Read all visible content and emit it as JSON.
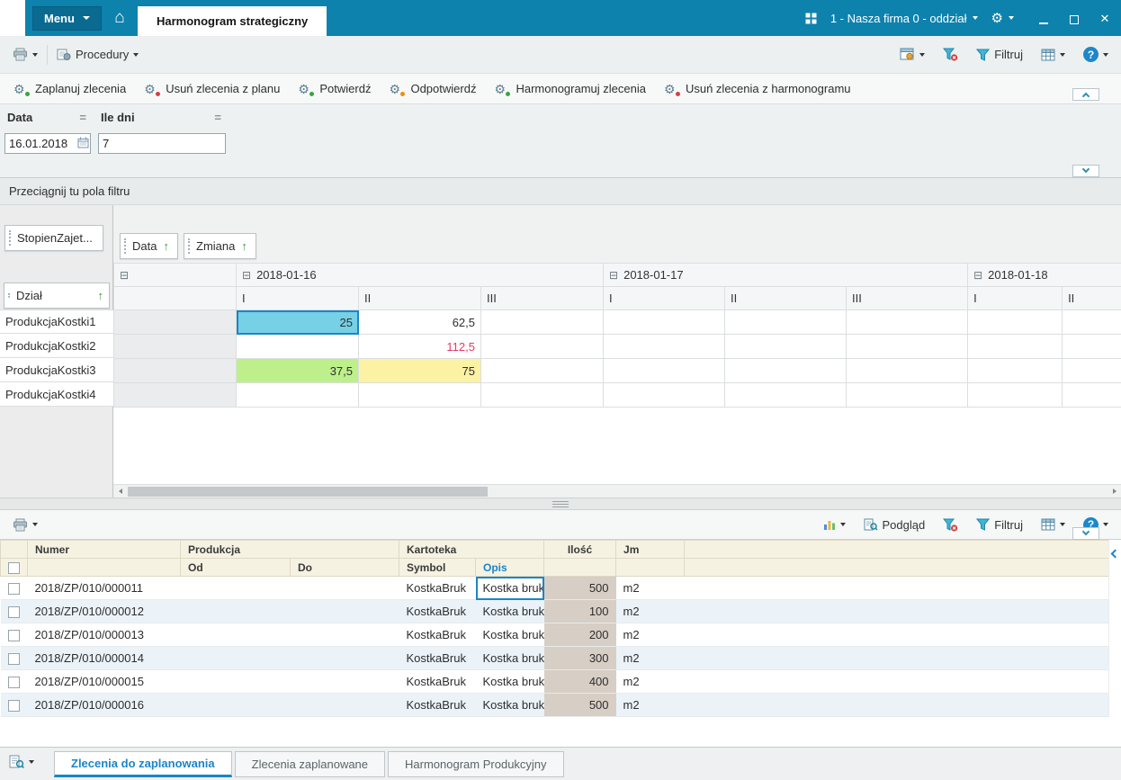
{
  "colors": {
    "titlebar": "#0d82ad",
    "accent_blue": "#1b85c8",
    "selected_cell": "#76d0e6",
    "cell_green": "#bdf08b",
    "cell_yellow": "#fbf2a4",
    "negative_red": "#e23b68",
    "ilosc_column_bg": "#d7cec6"
  },
  "icons": {
    "gears": "⚙",
    "home": "⌂",
    "sort_asc": "↑",
    "equals": "=",
    "collapse_box": "⊟",
    "question_mark": "?",
    "close": "✕"
  },
  "titlebar": {
    "menu_label": "Menu",
    "tab_title": "Harmonogram strategiczny",
    "company_selector": "1 - Nasza firma 0 - oddział"
  },
  "toolbar_top": {
    "procedures_label": "Procedury",
    "filter_label": "Filtruj"
  },
  "action_buttons": [
    {
      "label": "Zaplanuj zlecenia"
    },
    {
      "label": "Usuń zlecenia z planu"
    },
    {
      "label": "Potwierdź"
    },
    {
      "label": "Odpotwierdź"
    },
    {
      "label": "Harmonogramuj zlecenia"
    },
    {
      "label": "Usuń zlecenia z harmonogramu"
    }
  ],
  "params": {
    "date_label": "Data",
    "date_value": "16.01.2018",
    "days_label": "Ile dni",
    "days_value": "7"
  },
  "pivot": {
    "drop_hint": "Przeciągnij tu pola filtru",
    "data_field_label": "StopienZajet...",
    "column_field_1": "Data",
    "column_field_2": "Zmiana",
    "row_field": "Dział",
    "column_groups": [
      {
        "label": "2018-01-16",
        "subs": [
          "I",
          "II",
          "III"
        ]
      },
      {
        "label": "2018-01-17",
        "subs": [
          "I",
          "II",
          "III"
        ]
      },
      {
        "label": "2018-01-18",
        "subs": [
          "I",
          "II"
        ]
      }
    ],
    "rows": [
      {
        "label": "ProdukcjaKostki1",
        "values": [
          "25",
          "62,5",
          "",
          "",
          "",
          "",
          "",
          ""
        ]
      },
      {
        "label": "ProdukcjaKostki2",
        "values": [
          "",
          "112,5",
          "",
          "",
          "",
          "",
          "",
          ""
        ]
      },
      {
        "label": "ProdukcjaKostki3",
        "values": [
          "37,5",
          "75",
          "",
          "",
          "",
          "",
          "",
          ""
        ]
      },
      {
        "label": "ProdukcjaKostki4",
        "values": [
          "",
          "",
          "",
          "",
          "",
          "",
          "",
          ""
        ]
      }
    ]
  },
  "toolbar_bottom": {
    "preview_label": "Podgląd",
    "filter_label": "Filtruj"
  },
  "orders_grid": {
    "band_numer": "Numer",
    "band_produkcja": "Produkcja",
    "band_kartoteka": "Kartoteka",
    "band_ilosc": "Ilość",
    "band_jm": "Jm",
    "col_od": "Od",
    "col_do": "Do",
    "col_symbol": "Symbol",
    "col_opis": "Opis",
    "rows": [
      {
        "numer": "2018/ZP/010/000011",
        "od": "",
        "do": "",
        "symbol": "KostkaBruk",
        "opis": "Kostka bruk",
        "ilosc": "500",
        "jm": "m2"
      },
      {
        "numer": "2018/ZP/010/000012",
        "od": "",
        "do": "",
        "symbol": "KostkaBruk",
        "opis": "Kostka bruk",
        "ilosc": "100",
        "jm": "m2"
      },
      {
        "numer": "2018/ZP/010/000013",
        "od": "",
        "do": "",
        "symbol": "KostkaBruk",
        "opis": "Kostka bruk",
        "ilosc": "200",
        "jm": "m2"
      },
      {
        "numer": "2018/ZP/010/000014",
        "od": "",
        "do": "",
        "symbol": "KostkaBruk",
        "opis": "Kostka bruk",
        "ilosc": "300",
        "jm": "m2"
      },
      {
        "numer": "2018/ZP/010/000015",
        "od": "",
        "do": "",
        "symbol": "KostkaBruk",
        "opis": "Kostka bruk",
        "ilosc": "400",
        "jm": "m2"
      },
      {
        "numer": "2018/ZP/010/000016",
        "od": "",
        "do": "",
        "symbol": "KostkaBruk",
        "opis": "Kostka bruk",
        "ilosc": "500",
        "jm": "m2"
      }
    ]
  },
  "bottom_tabs": [
    {
      "label": "Zlecenia do zaplanowania",
      "active": true
    },
    {
      "label": "Zlecenia zaplanowane",
      "active": false
    },
    {
      "label": "Harmonogram Produkcyjny",
      "active": false
    }
  ]
}
